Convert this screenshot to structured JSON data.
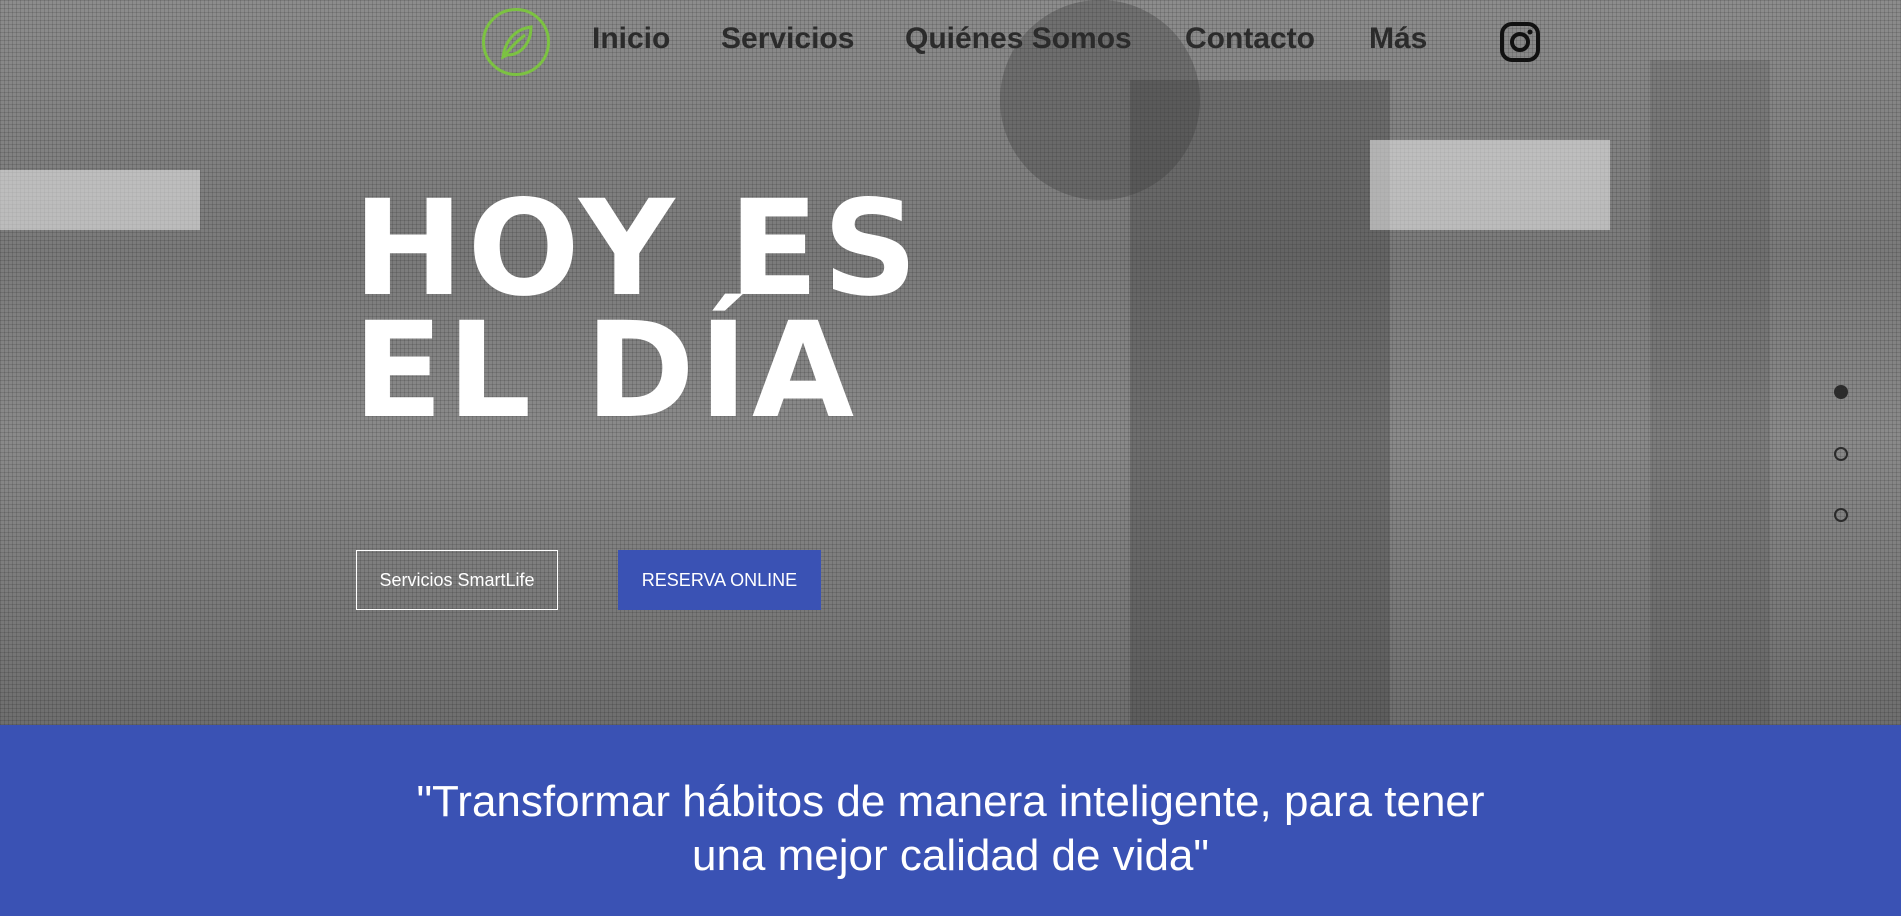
{
  "nav": {
    "items": [
      {
        "label": "Inicio"
      },
      {
        "label": "Servicios"
      },
      {
        "label": "Quiénes Somos"
      },
      {
        "label": "Contacto"
      },
      {
        "label": "Más"
      }
    ],
    "logo_icon": "leaf-logo-icon",
    "social_icon": "instagram-icon"
  },
  "hero": {
    "headline_line1": "HOY ES",
    "headline_line2": "EL DÍA",
    "btn_services": "Servicios SmartLife",
    "btn_booking": "RESERVA ONLINE",
    "slides": {
      "count": 3,
      "active": 1
    }
  },
  "quote": {
    "line1": "\"Transformar hábitos de manera inteligente, para tener",
    "line2": "una mejor calidad de vida\""
  },
  "colors": {
    "brand_blue": "#3a52b4",
    "logo_green": "#7cc242",
    "nav_text": "#2b2b2b"
  }
}
